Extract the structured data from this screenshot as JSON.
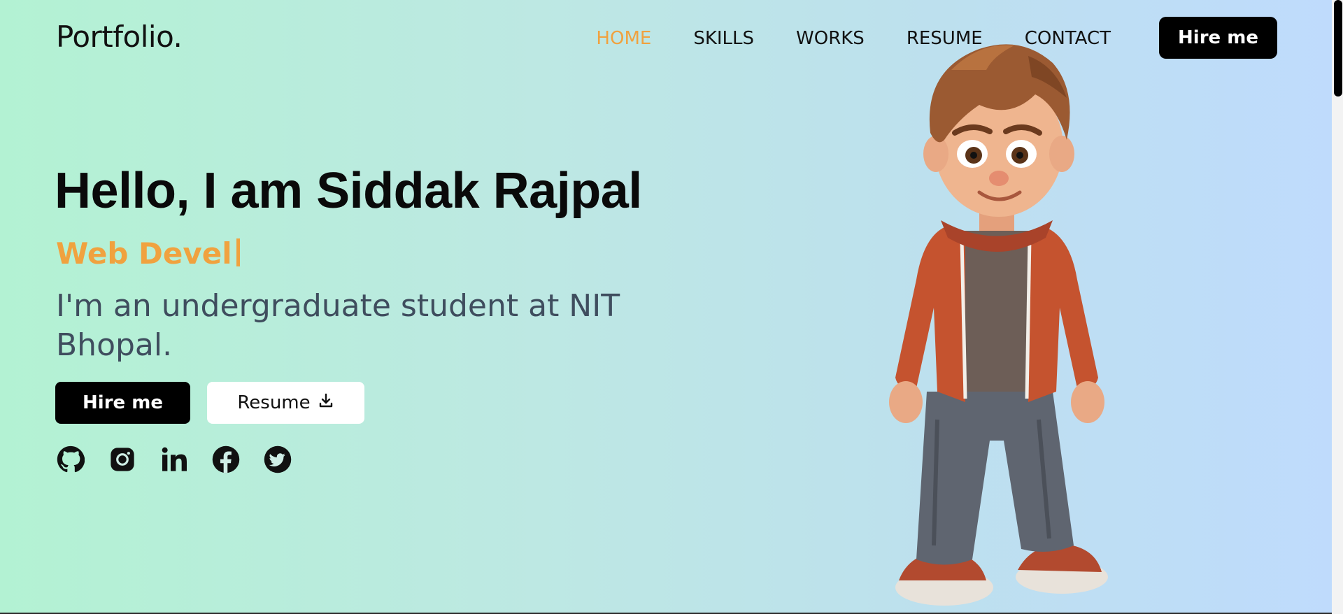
{
  "header": {
    "logo": "Portfolio.",
    "nav": [
      "HOME",
      "SKILLS",
      "WORKS",
      "RESUME",
      "CONTACT"
    ],
    "active": "HOME",
    "hire_label": "Hire me"
  },
  "hero": {
    "title": "Hello, I am Siddak Rajpal",
    "typed_text": "Web Devel",
    "intro": "I'm an undergraduate student at NIT Bhopal.",
    "hire_label": "Hire me",
    "resume_label": "Resume"
  },
  "socials": [
    "github-icon",
    "instagram-icon",
    "linkedin-icon",
    "facebook-icon",
    "twitter-icon"
  ],
  "colors": {
    "accent": "#f0a23f",
    "text": "#0a0a0a",
    "subtext": "#3f4d5e",
    "button": "#000000"
  }
}
